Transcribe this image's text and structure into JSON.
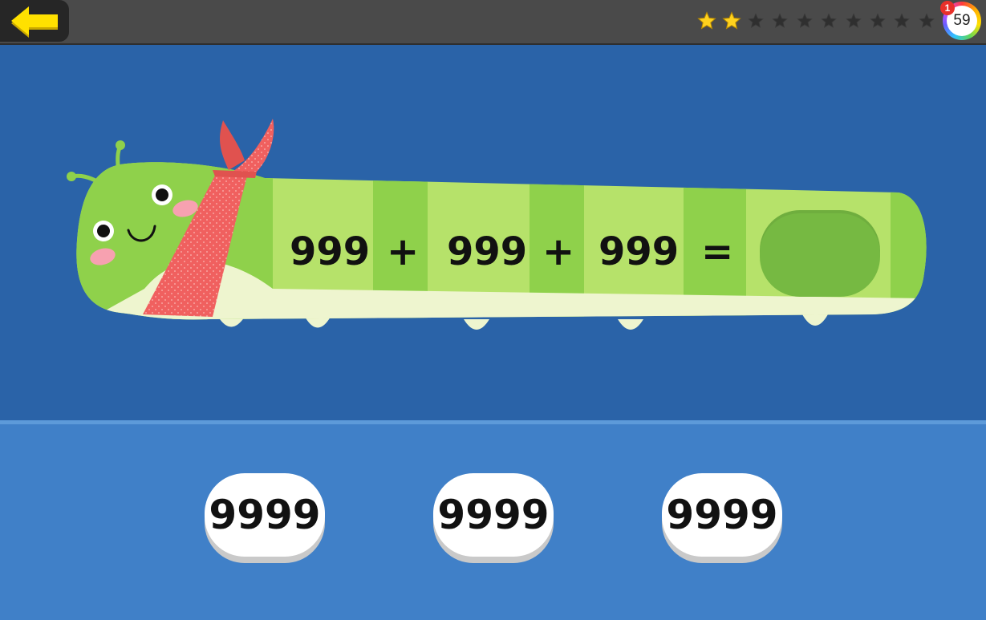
{
  "header": {
    "back_icon": "back-arrow-icon",
    "stars_earned": 2,
    "stars_total": 10,
    "score": "59",
    "notification_count": "1"
  },
  "equation": {
    "operand1": "999",
    "plus1": "+",
    "operand2": "999",
    "plus2": "+",
    "operand3": "999",
    "equals": "="
  },
  "choices": [
    {
      "label": "9999"
    },
    {
      "label": "9999"
    },
    {
      "label": "9999"
    }
  ],
  "colors": {
    "topbar": "#4a4a4a",
    "play_area": "#2a63a8",
    "answer_area": "#4080c8",
    "caterpillar_light": "#b6e26a",
    "caterpillar_dark": "#8fd14b",
    "scarf": "#f0605f",
    "star_gold": "#ffd21e"
  }
}
